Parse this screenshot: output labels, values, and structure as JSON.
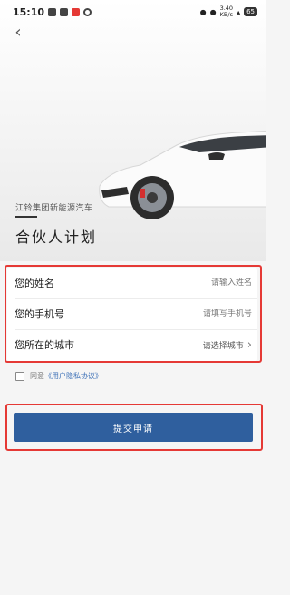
{
  "status_bar": {
    "time": "15:10",
    "net_speed": "3.40",
    "net_unit": "KB/s",
    "battery": "65"
  },
  "hero": {
    "brand_sub": "江铃集团新能源汽车",
    "title": "合伙人计划"
  },
  "form": {
    "name_label": "您的姓名",
    "name_placeholder": "请输入姓名",
    "phone_label": "您的手机号",
    "phone_placeholder": "请填写手机号",
    "city_label": "您所在的城市",
    "city_placeholder": "请选择城市"
  },
  "consent": {
    "prefix": "同意",
    "link": "《用户隐私协议》"
  },
  "submit_label": "提交申请",
  "colors": {
    "accent": "#2f5f9e",
    "highlight": "#e53935"
  },
  "icons": {
    "back": "chevron-left-icon",
    "city_arrow": "chevron-right-icon"
  }
}
